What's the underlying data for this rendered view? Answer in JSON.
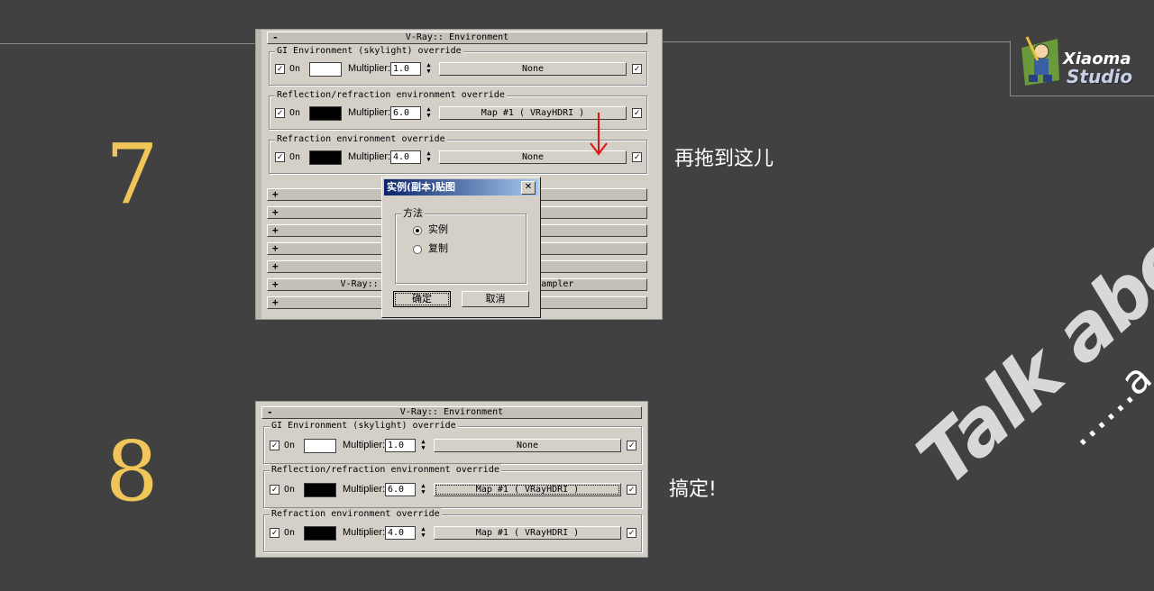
{
  "steps": [
    {
      "number": "7",
      "caption": "再拖到这儿"
    },
    {
      "number": "8",
      "caption": "搞定!"
    }
  ],
  "logo": {
    "line1": "Xiaoma",
    "line2": "Studio"
  },
  "watermark": {
    "line1": "Talk about",
    "line2": "......a chair"
  },
  "panel7": {
    "rollout_minus": "-",
    "title": "V-Ray:: Environment",
    "groups": [
      {
        "title": "GI Environment (skylight) override",
        "on": "On",
        "multiplier_label": "Multiplier:",
        "multiplier": "1.0",
        "map": "None",
        "swatch": "#ffffff"
      },
      {
        "title": "Reflection/refraction environment override",
        "on": "On",
        "multiplier_label": "Multiplier:",
        "multiplier": "6.0",
        "map": "Map #1  ( VRayHDRI )",
        "swatch": "#000000"
      },
      {
        "title": "Refraction environment override",
        "on": "On",
        "multiplier_label": "Multiplier:",
        "multiplier": "4.0",
        "map": "None",
        "swatch": "#000000"
      }
    ],
    "collapsed_rollouts": [
      {
        "sign": "+",
        "title": ""
      },
      {
        "sign": "+",
        "title": ""
      },
      {
        "sign": "+",
        "title": ""
      },
      {
        "sign": "+",
        "title": ""
      },
      {
        "sign": "+",
        "title": ""
      },
      {
        "sign": "+",
        "title": "V-Ray::                              ampler"
      },
      {
        "sign": "+",
        "title": ""
      }
    ]
  },
  "dialog": {
    "title": "实例(副本)贴图",
    "close": "✕",
    "group_title": "方法",
    "options": [
      "实例",
      "复制"
    ],
    "selected": 0,
    "ok": "确定",
    "cancel": "取消"
  },
  "panel8": {
    "rollout_minus": "-",
    "title": "V-Ray:: Environment",
    "groups": [
      {
        "title": "GI Environment (skylight) override",
        "on": "On",
        "multiplier_label": "Multiplier:",
        "multiplier": "1.0",
        "map": "None",
        "swatch": "#ffffff"
      },
      {
        "title": "Reflection/refraction environment override",
        "on": "On",
        "multiplier_label": "Multiplier:",
        "multiplier": "6.0",
        "map": "Map #1  ( VRayHDRI )",
        "swatch": "#000000"
      },
      {
        "title": "Refraction environment override",
        "on": "On",
        "multiplier_label": "Multiplier:",
        "multiplier": "4.0",
        "map": "Map #1  ( VRayHDRI )",
        "swatch": "#000000"
      }
    ]
  },
  "colors": {
    "background": "#414141",
    "step_number": "#f0c65a",
    "arrow": "#e01010",
    "panel": "#d4d0c8"
  }
}
